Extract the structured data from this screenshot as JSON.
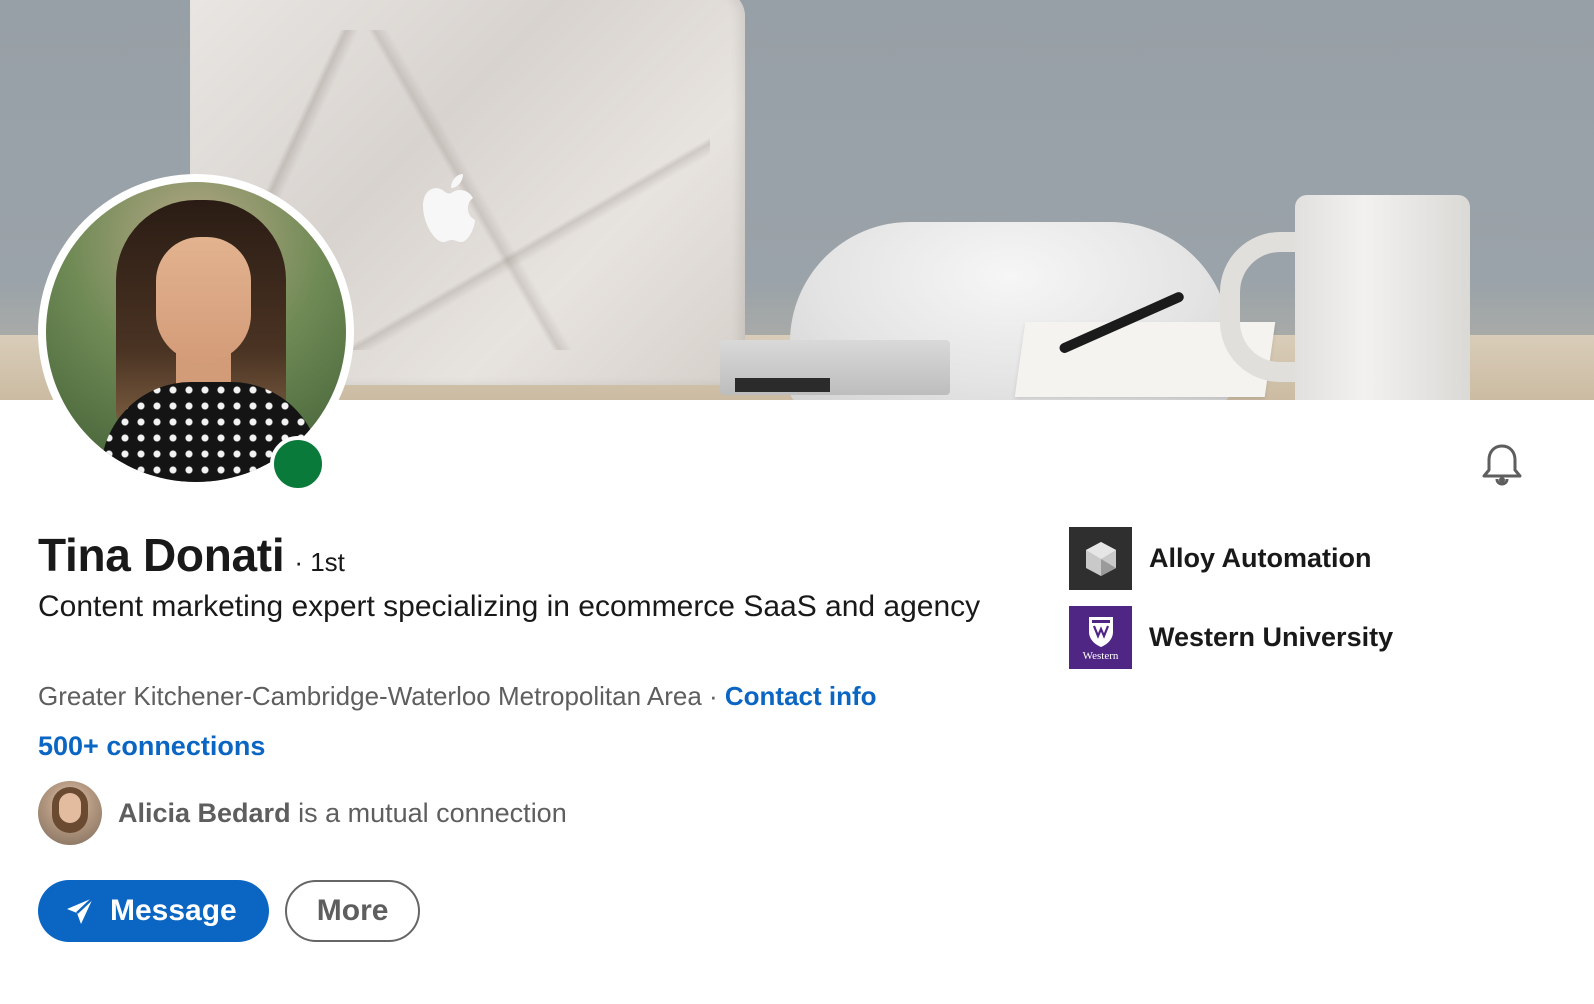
{
  "profile": {
    "name": "Tina Donati",
    "degree": "· 1st",
    "headline": "Content marketing expert specializing in ecommerce SaaS and agency",
    "location": "Greater Kitchener-Cambridge-Waterloo Metropolitan Area",
    "location_separator": " · ",
    "contact_info_label": "Contact info",
    "connections_label": "500+ connections",
    "online_status": "online"
  },
  "mutual": {
    "name": "Alicia Bedard",
    "text": " is a mutual connection"
  },
  "actions": {
    "message_label": "Message",
    "more_label": "More"
  },
  "organizations": [
    {
      "name": "Alloy Automation",
      "logo": "alloy-logo"
    },
    {
      "name": "Western University",
      "logo": "western-logo",
      "logo_text": "Western"
    }
  ],
  "colors": {
    "accent": "#0a66c2",
    "online": "#0a7a3a",
    "western_purple": "#4f2683"
  },
  "icons": {
    "bell": "bell-icon",
    "message": "paper-plane-icon"
  }
}
